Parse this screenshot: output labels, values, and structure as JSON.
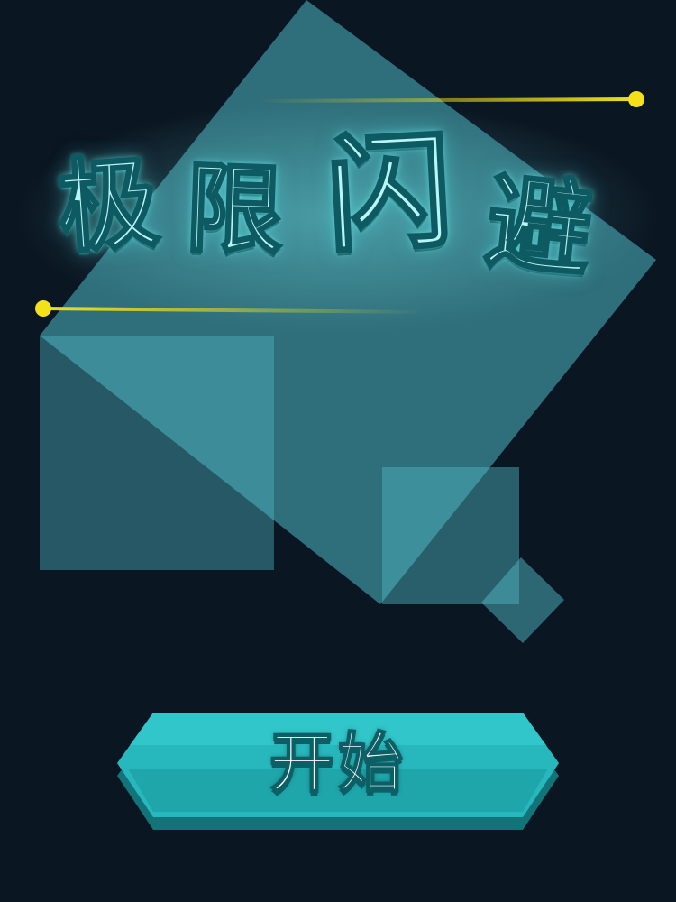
{
  "title": {
    "chars": [
      "极",
      "限",
      "闪",
      "避"
    ]
  },
  "start_button": {
    "label": "开始"
  },
  "colors": {
    "background": "#0a1622",
    "shape_teal": "#4fb8c4",
    "title_fill": "#b8f6f6",
    "title_stroke": "#0e5a62",
    "laser_yellow": "#f3e21a",
    "button_teal": "#27b8bd",
    "button_dark": "#14878e"
  }
}
